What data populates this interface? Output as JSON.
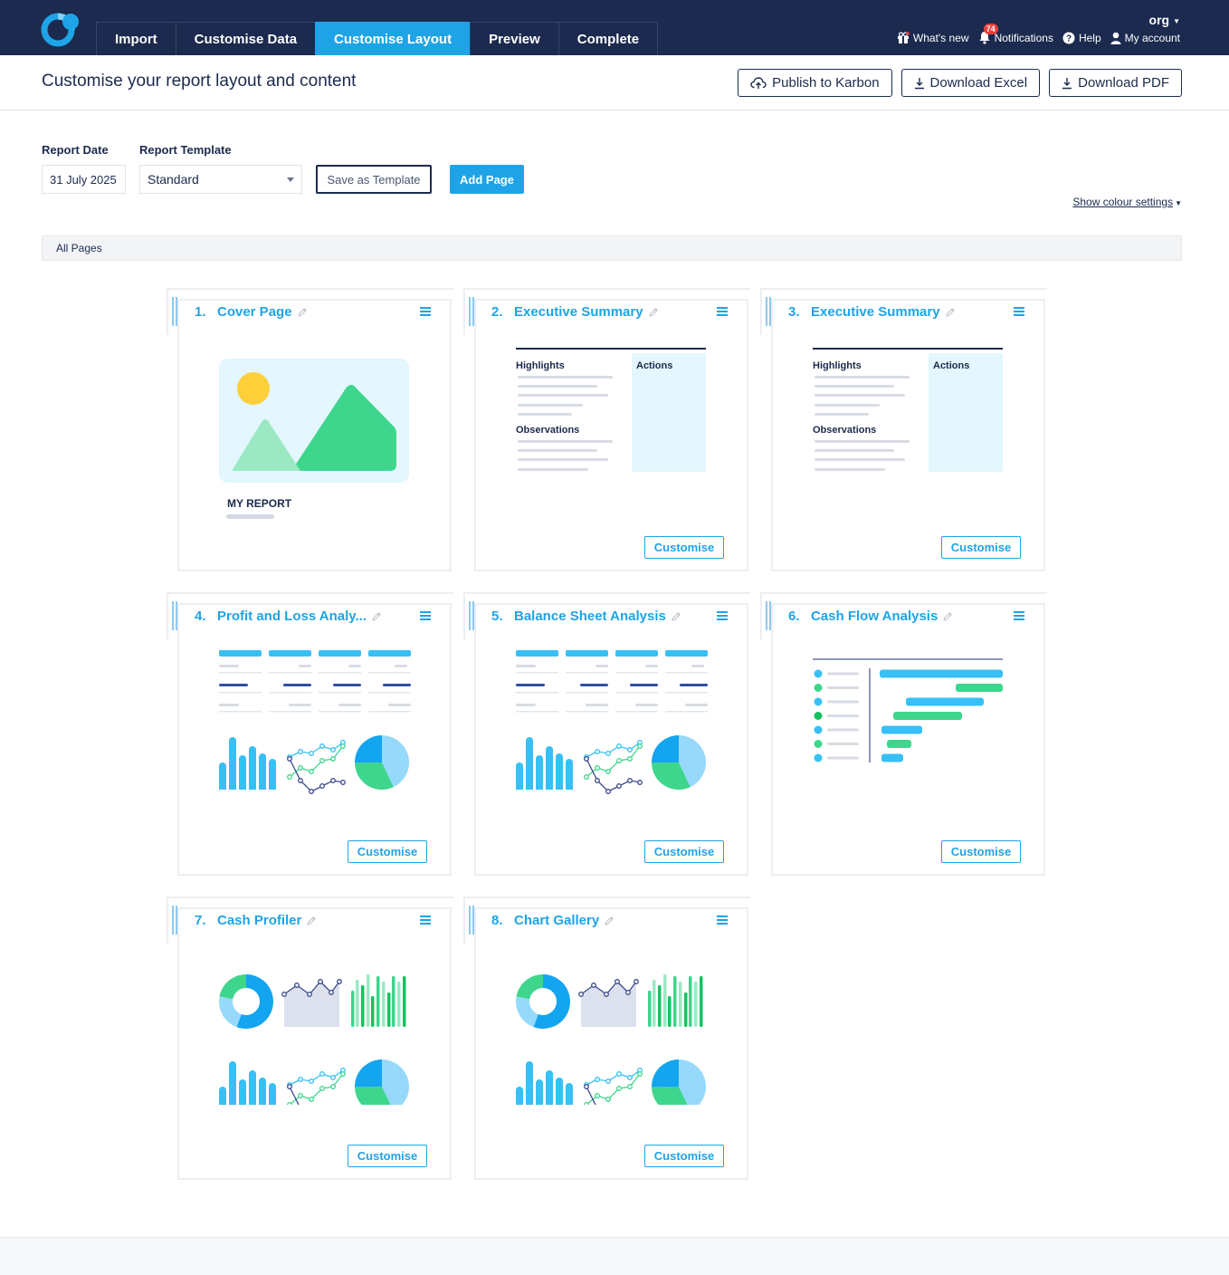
{
  "app": {
    "org_name": "org",
    "nav_tabs": [
      {
        "label": "Import",
        "active": false
      },
      {
        "label": "Customise Data",
        "active": false
      },
      {
        "label": "Customise Layout",
        "active": true
      },
      {
        "label": "Preview",
        "active": false
      },
      {
        "label": "Complete",
        "active": false
      }
    ],
    "utilities": {
      "whats_new": "What's new",
      "notifications": "Notifications",
      "notifications_count": "74",
      "help": "Help",
      "my_account": "My account"
    }
  },
  "header": {
    "title": "Customise your report layout and content",
    "actions": {
      "publish": "Publish to Karbon",
      "download_excel": "Download Excel",
      "download_pdf": "Download PDF"
    }
  },
  "controls": {
    "report_date_label": "Report Date",
    "report_date_value": "31 July 2025",
    "report_template_label": "Report Template",
    "report_template_value": "Standard",
    "save_as_template": "Save as Template",
    "add_page": "Add Page",
    "colour_settings": "Show colour settings"
  },
  "pages_filter": "All Pages",
  "cards": [
    {
      "num": "1.",
      "title": "Cover Page",
      "thumb": "cover",
      "thumb_title": "MY REPORT",
      "has_customise": false
    },
    {
      "num": "2.",
      "title": "Executive Summary",
      "thumb": "summary",
      "labels": [
        "Highlights",
        "Actions",
        "Observations"
      ],
      "has_customise": true
    },
    {
      "num": "3.",
      "title": "Executive Summary",
      "thumb": "summary",
      "labels": [
        "Highlights",
        "Actions",
        "Observations"
      ],
      "has_customise": true
    },
    {
      "num": "4.",
      "title": "Profit and Loss Analy...",
      "thumb": "analysis",
      "has_customise": true
    },
    {
      "num": "5.",
      "title": "Balance Sheet Analysis",
      "thumb": "analysis",
      "has_customise": true
    },
    {
      "num": "6.",
      "title": "Cash Flow Analysis",
      "thumb": "cashflow",
      "has_customise": true
    },
    {
      "num": "7.",
      "title": "Cash Profiler",
      "thumb": "gallery",
      "has_customise": true
    },
    {
      "num": "8.",
      "title": "Chart Gallery",
      "thumb": "gallery",
      "has_customise": true
    }
  ],
  "customise_label": "Customise",
  "colors": {
    "navy": "#1b2a4e",
    "accent_blue": "#1ea4e6",
    "chart_blue": "#37c0f5",
    "chart_green": "#3dd68c",
    "light_blue_panel": "#e4f6fe",
    "sun_yellow": "#fdd03a"
  }
}
